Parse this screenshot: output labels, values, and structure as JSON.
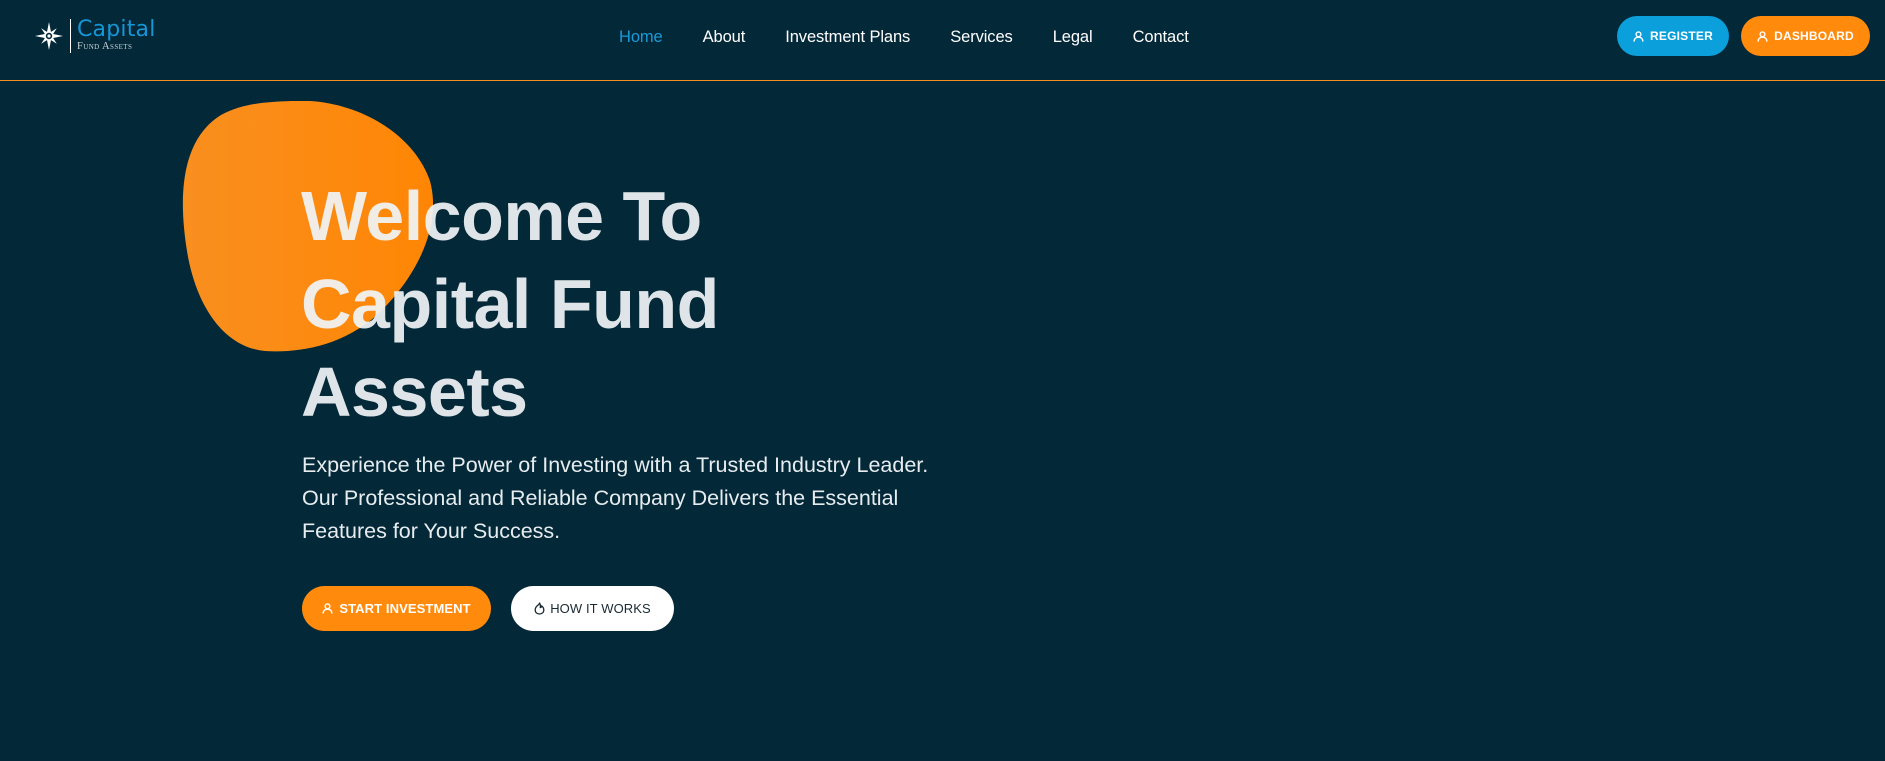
{
  "brand": {
    "name": "Capital",
    "tagline": "Fund Assets",
    "logo_icon": "compass-star-icon"
  },
  "nav": {
    "items": [
      {
        "label": "Home",
        "active": true
      },
      {
        "label": "About",
        "active": false
      },
      {
        "label": "Investment Plans",
        "active": false
      },
      {
        "label": "Services",
        "active": false
      },
      {
        "label": "Legal",
        "active": false
      },
      {
        "label": "Contact",
        "active": false
      }
    ]
  },
  "header_actions": {
    "register_label": "REGISTER",
    "register_icon": "user-icon",
    "dashboard_label": "DASHBOARD",
    "dashboard_icon": "user-icon"
  },
  "hero": {
    "title_line1": "Welcome To",
    "title_line2": "Capital Fund",
    "title_line3": "Assets",
    "subtitle": "Experience the Power of Investing with a Trusted Industry Leader. Our Professional and Reliable Company Delivers the Essential Features for Your Success.",
    "primary_cta": {
      "label": "START INVESTMENT",
      "icon": "user-icon"
    },
    "secondary_cta": {
      "label": "HOW IT WORKS",
      "icon": "fire-icon"
    }
  },
  "colors": {
    "background": "#032838",
    "accent_orange": "#ff8a0c",
    "accent_blue": "#0b9fdc",
    "header_border": "#f68e1e",
    "nav_active": "#1a9ad8"
  }
}
